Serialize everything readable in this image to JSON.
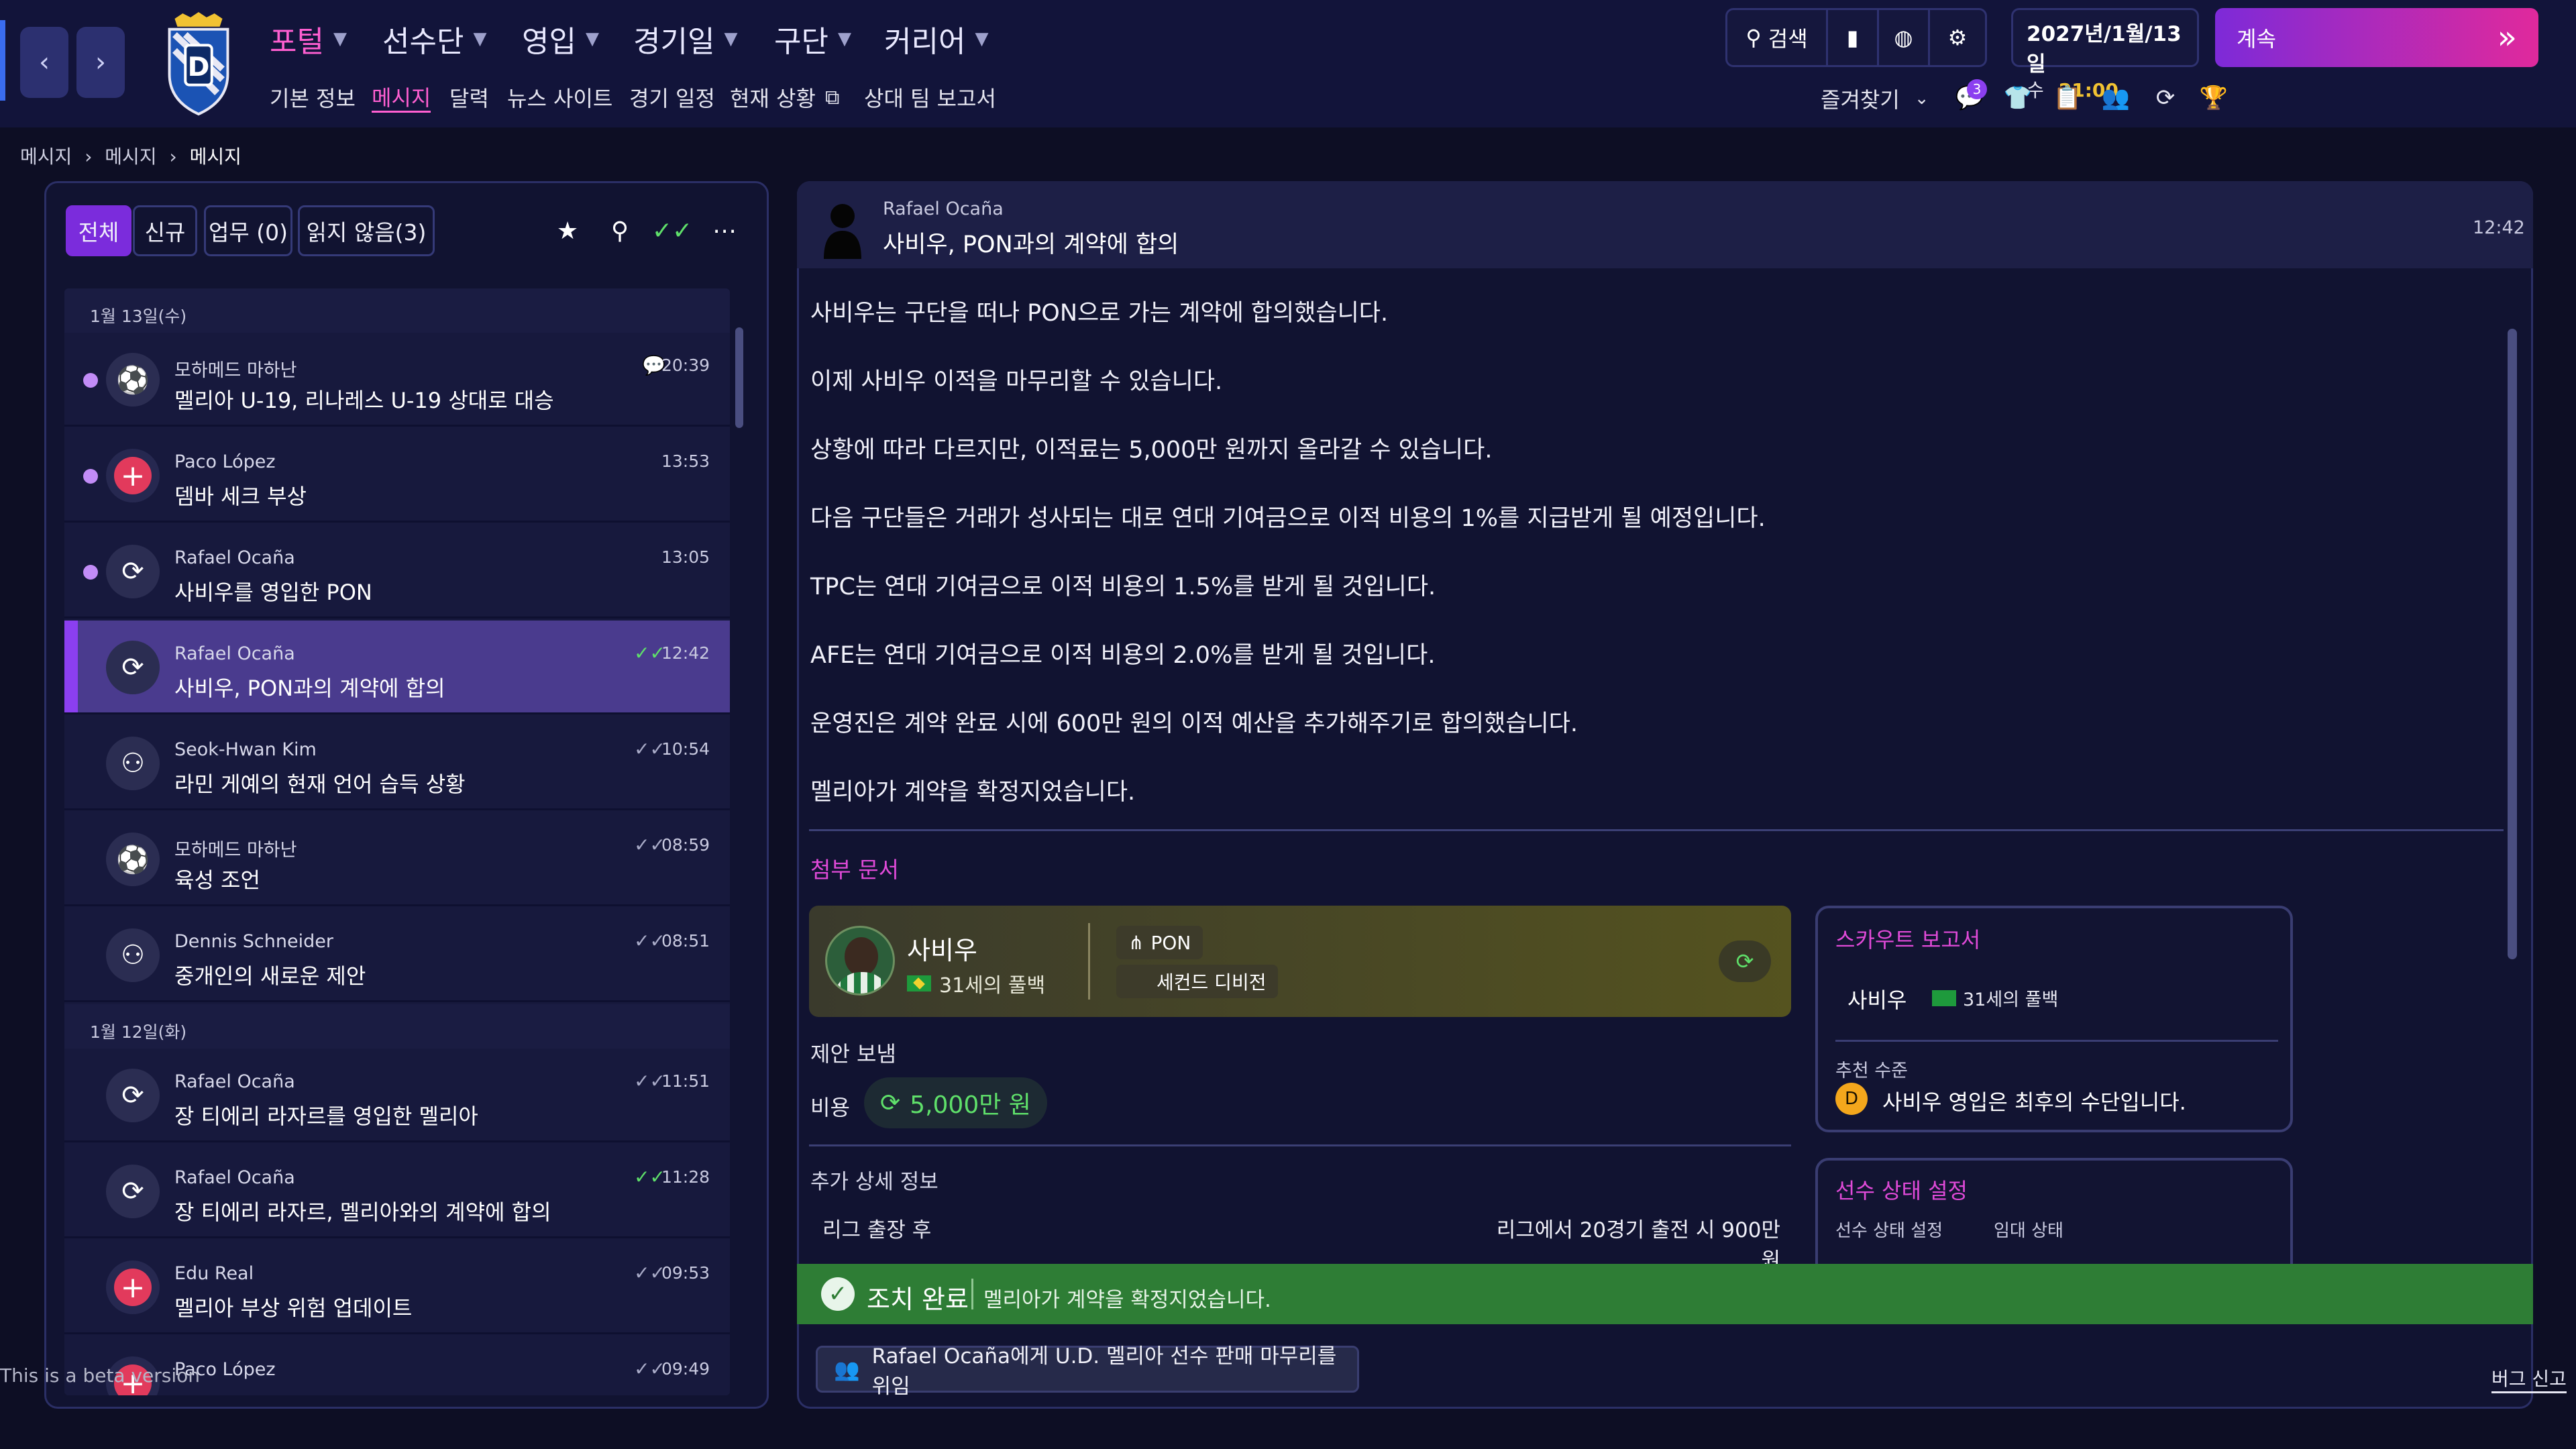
{
  "nav": {
    "back_icon": "chevron-left-icon",
    "forward_icon": "chevron-right-icon",
    "menus": [
      "포털",
      "선수단",
      "영입",
      "경기일",
      "구단",
      "커리어"
    ],
    "submenus": [
      "기본 정보",
      "메시지",
      "달력",
      "뉴스 사이트",
      "경기 일정",
      "현재 상황",
      "상대 팀 보고서"
    ],
    "active_submenu": "메시지",
    "search_label": "검색",
    "date_line1": "2027년/1월/13일",
    "date_weekday": "수",
    "date_time": "21:00",
    "continue_label": "계속",
    "favorites_label": "즐겨찾기",
    "notification_count": "3",
    "accent": "#ff5fd1",
    "continue_gradient": [
      "#7d2ad8",
      "#e0299c"
    ]
  },
  "breadcrumb": [
    "메시지",
    "메시지",
    "메시지"
  ],
  "filters": {
    "tabs": [
      "전체",
      "신규",
      "업무 (0)",
      "읽지 않음(3)"
    ],
    "active": "전체"
  },
  "inbox": {
    "groups": [
      {
        "date": "1월 13일(수)",
        "messages": [
          {
            "sender": "모하메드 마하난",
            "subject": "멜리아 U-19, 리나레스 U-19 상대로 대승",
            "time": "20:39",
            "unread": true,
            "icon": "team-icon",
            "status": "speech-bubble-icon"
          },
          {
            "sender": "Paco López",
            "subject": "뎀바 세크 부상",
            "time": "13:53",
            "unread": true,
            "icon": "medical-cross-icon",
            "status": ""
          },
          {
            "sender": "Rafael Ocaña",
            "subject": "사비우를 영입한 PON",
            "time": "13:05",
            "unread": true,
            "icon": "transfer-cycle-icon",
            "status": ""
          },
          {
            "sender": "Rafael Ocaña",
            "subject": "사비우, PON과의 계약에 합의",
            "time": "12:42",
            "unread": false,
            "selected": true,
            "icon": "transfer-cycle-icon",
            "status": "double-check-green-icon"
          },
          {
            "sender": "Seok-Hwan Kim",
            "subject": "라민 게예의 현재 언어 습득 상황",
            "time": "10:54",
            "unread": false,
            "icon": "people-icon",
            "status": "double-check-icon"
          },
          {
            "sender": "모하메드 마하난",
            "subject": "육성 조언",
            "time": "08:59",
            "unread": false,
            "icon": "team-icon",
            "status": "double-check-icon"
          },
          {
            "sender": "Dennis Schneider",
            "subject": "중개인의 새로운 제안",
            "time": "08:51",
            "unread": false,
            "icon": "people-icon",
            "status": "double-check-icon"
          }
        ]
      },
      {
        "date": "1월 12일(화)",
        "messages": [
          {
            "sender": "Rafael Ocaña",
            "subject": "장 티에리 라자르를 영입한 멜리아",
            "time": "11:51",
            "unread": false,
            "icon": "transfer-cycle-icon",
            "status": "double-check-icon"
          },
          {
            "sender": "Rafael Ocaña",
            "subject": "장 티에리 라자르, 멜리아와의 계약에 합의",
            "time": "11:28",
            "unread": false,
            "icon": "transfer-cycle-icon",
            "status": "double-check-green-icon"
          },
          {
            "sender": "Edu Real",
            "subject": "멜리아 부상 위험 업데이트",
            "time": "09:53",
            "unread": false,
            "icon": "medical-cross-icon",
            "status": "double-check-icon"
          },
          {
            "sender": "Paco López",
            "subject": "",
            "time": "09:49",
            "unread": false,
            "icon": "medical-cross-icon",
            "status": "double-check-icon"
          }
        ]
      }
    ]
  },
  "message": {
    "sender": "Rafael Ocaña",
    "title": "사비우, PON과의 계약에 합의",
    "time": "12:42",
    "body": [
      "사비우는 구단을 떠나 PON으로 가는 계약에 합의했습니다.",
      "이제 사비우 이적을 마무리할 수 있습니다.",
      "상황에 따라 다르지만, 이적료는 5,000만 원까지 올라갈 수 있습니다.",
      "다음 구단들은 거래가 성사되는 대로 연대 기여금으로 이적 비용의 1%를 지급받게 될 예정입니다.",
      "TPC는 연대 기여금으로 이적 비용의 1.5%를 받게 될 것입니다.",
      "AFE는 연대 기여금으로 이적 비용의 2.0%를 받게 될 것입니다.",
      "운영진은 계약 완료 시에 600만 원의 이적 예산을 추가해주기로 합의했습니다.",
      "멜리아가 계약을 확정지었습니다."
    ],
    "attachments_title": "첨부 문서",
    "player": {
      "name": "사비우",
      "age_position": "31세의 풀백",
      "club": "PON",
      "league": "세컨드 디비전",
      "flag": "brazil-flag-icon"
    },
    "offer_label": "제안 보냄",
    "cost_label": "비용",
    "cost_value": "5,000만 원",
    "extra_title": "추가 상세 정보",
    "extra_rows": [
      {
        "label": "리그 출장 후",
        "value": "리그에서 20경기 출전 시 900만 원"
      }
    ],
    "scout": {
      "title": "스카우트 보고서",
      "player": "사비우",
      "age_position": "31세의 풀백",
      "rec_label": "추천 수준",
      "rec_grade": "D",
      "rec_text": "사비우 영입은 최후의 수단입니다."
    },
    "status_panel": {
      "title": "선수 상태 설정",
      "col1": "선수 상태 설정",
      "col2": "임대 상태"
    },
    "action_done_label": "조치 완료",
    "action_done_text": "멜리아가 계약을 확정지었습니다.",
    "delegate_label": "Rafael Ocaña에게 U.D. 멜리아 선수 판매 마무리를 위임"
  },
  "footer": {
    "beta": "This is a beta version",
    "bug": "버그 신고"
  }
}
